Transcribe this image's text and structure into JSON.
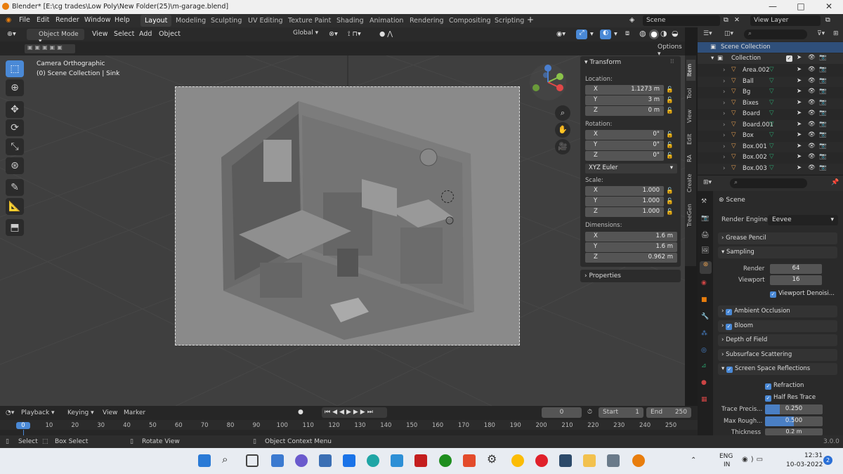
{
  "title_bar": {
    "text": "Blender* [E:\\cg trades\\Low Poly\\New Folder(25)\\m-garage.blend]",
    "minimize": "—",
    "maximize": "□",
    "close": "✕"
  },
  "menu": [
    "File",
    "Edit",
    "Render",
    "Window",
    "Help"
  ],
  "workspaces": [
    "Layout",
    "Modeling",
    "Sculpting",
    "UV Editing",
    "Texture Paint",
    "Shading",
    "Animation",
    "Rendering",
    "Compositing",
    "Scripting"
  ],
  "scene_label": "Scene",
  "view_layer_label": "View Layer",
  "viewport_header": {
    "mode": "Object Mode",
    "menus": [
      "View",
      "Select",
      "Add",
      "Object"
    ],
    "transform_orientation": "Global",
    "options_label": "Options"
  },
  "viewport": {
    "camera_text": "Camera Orthographic",
    "collection_text": "(0) Scene Collection | Sink"
  },
  "transform_panel": {
    "title": "Transform",
    "location_label": "Location:",
    "location": {
      "x": "1.1273 m",
      "y": "3 m",
      "z": "0 m"
    },
    "rotation_label": "Rotation:",
    "rotation": {
      "x": "0°",
      "y": "0°",
      "z": "0°"
    },
    "rotation_mode": "XYZ Euler",
    "scale_label": "Scale:",
    "scale": {
      "x": "1.000",
      "y": "1.000",
      "z": "1.000"
    },
    "dimensions_label": "Dimensions:",
    "dimensions": {
      "x": "1.6 m",
      "y": "1.6 m",
      "z": "0.962 m"
    },
    "properties_label": "Properties",
    "axis_labels": {
      "x": "X",
      "y": "Y",
      "z": "Z"
    }
  },
  "side_tabs": [
    "Item",
    "Tool",
    "View",
    "Edit",
    "RA",
    "Create",
    "TreeGen"
  ],
  "outliner": {
    "scene_collection": "Scene Collection",
    "collection": "Collection",
    "items": [
      "Area.002",
      "Ball",
      "Bg",
      "Bixes",
      "Board",
      "Board.001",
      "Box",
      "Box.001",
      "Box.002",
      "Box.003"
    ]
  },
  "properties": {
    "scene_label": "Scene",
    "render_engine_label": "Render Engine",
    "render_engine": "Eevee",
    "sections": {
      "grease_pencil": "Grease Pencil",
      "sampling": "Sampling",
      "ambient_occlusion": "Ambient Occlusion",
      "bloom": "Bloom",
      "depth_of_field": "Depth of Field",
      "subsurface_scattering": "Subsurface Scattering",
      "ssr": "Screen Space Reflections"
    },
    "render_label": "Render",
    "render_samples": "64",
    "viewport_label": "Viewport",
    "viewport_samples": "16",
    "viewport_denoise": "Viewport Denoisi...",
    "refraction": "Refraction",
    "half_res_trace": "Half Res Trace",
    "trace_precision_label": "Trace Precis...",
    "trace_precision": "0.250",
    "trace_precision_fill": 0.25,
    "max_roughness_label": "Max Rough...",
    "max_roughness": "0.500",
    "max_roughness_fill": 0.5,
    "thickness_label": "Thickness",
    "thickness": "0.2 m"
  },
  "timeline": {
    "menus": [
      "Playback",
      "Keying",
      "View",
      "Marker"
    ],
    "current_frame": "0",
    "start_label": "Start",
    "start": "1",
    "end_label": "End",
    "end": "250",
    "ticks": [
      "0",
      "10",
      "20",
      "30",
      "40",
      "50",
      "60",
      "70",
      "80",
      "90",
      "100",
      "110",
      "120",
      "130",
      "140",
      "150",
      "160",
      "170",
      "180",
      "190",
      "200",
      "210",
      "220",
      "230",
      "240",
      "250"
    ]
  },
  "status": {
    "select": "Select",
    "box_select": "Box Select",
    "rotate_view": "Rotate View",
    "context_menu": "Object Context Menu",
    "version": "3.0.0"
  },
  "taskbar": {
    "lang": "ENG",
    "lang2": "IN",
    "time": "12:31",
    "date": "10-03-2022",
    "badge": "2"
  },
  "colors": {
    "accent": "#4a89d6",
    "active_collection": "#2f4f7a",
    "background": "#3f3f3f"
  }
}
